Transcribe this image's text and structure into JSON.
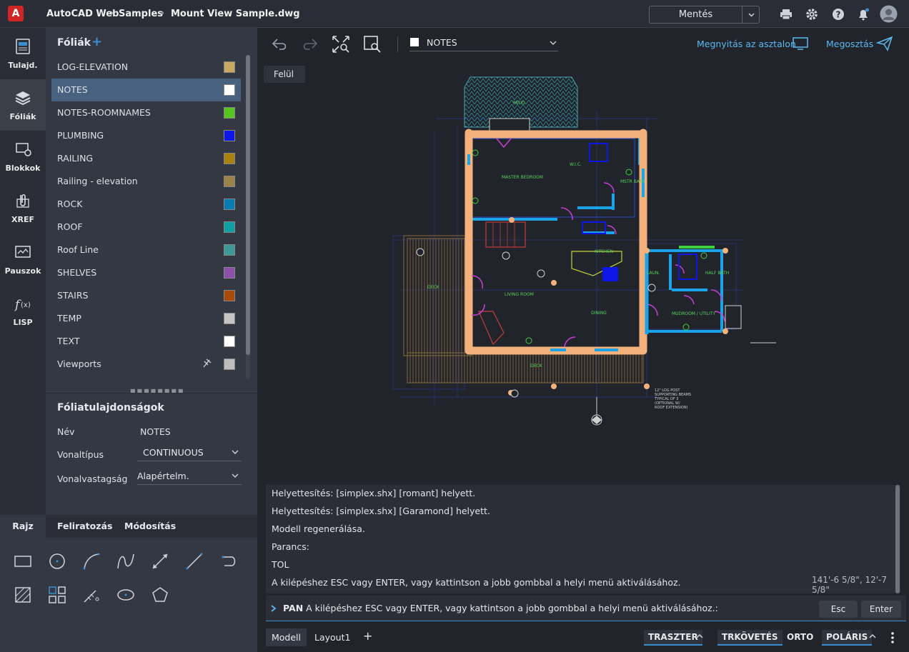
{
  "app": {
    "logo_letter": "A",
    "breadcrumb": [
      "AutoCAD Web",
      "Samples",
      "Mount View Sample.dwg"
    ],
    "save_label": "Mentés",
    "icons": [
      "printer-icon",
      "gear-icon",
      "help-icon",
      "bell-icon",
      "avatar"
    ]
  },
  "leftstrip": {
    "items": [
      {
        "label": "Tulajd.",
        "icon": "properties-icon"
      },
      {
        "label": "Fóliák",
        "icon": "layers-icon",
        "active": true
      },
      {
        "label": "Blokkok",
        "icon": "blocks-icon"
      },
      {
        "label": "XREF",
        "icon": "xref-icon"
      },
      {
        "label": "Pauszok",
        "icon": "trace-icon"
      },
      {
        "label": "LISP",
        "icon": "lisp-icon"
      }
    ]
  },
  "layers_panel": {
    "title": "Fóliák",
    "add_symbol": "+",
    "layers": [
      {
        "name": "LOG-ELEVATION",
        "color": "#c8a862"
      },
      {
        "name": "NOTES",
        "color": "#ffffff",
        "selected": true
      },
      {
        "name": "NOTES-ROOMNAMES",
        "color": "#56c51f"
      },
      {
        "name": "PLUMBING",
        "color": "#0f17e8"
      },
      {
        "name": "RAILING",
        "color": "#a98111"
      },
      {
        "name": "Railing - elevation",
        "color": "#9a8349"
      },
      {
        "name": "ROCK",
        "color": "#087bb0"
      },
      {
        "name": "ROOF",
        "color": "#0f9fa3"
      },
      {
        "name": "Roof Line",
        "color": "#3e9994"
      },
      {
        "name": "SHELVES",
        "color": "#8c50a8"
      },
      {
        "name": "STAIRS",
        "color": "#a54b0c"
      },
      {
        "name": "TEMP",
        "color": "#c5c5c5"
      },
      {
        "name": "TEXT",
        "color": "#ffffff"
      },
      {
        "name": "Viewports",
        "color": "#bdbdbd"
      }
    ]
  },
  "layer_props": {
    "title": "Fóliatulajdonságok",
    "name_label": "Név",
    "name_value": "NOTES",
    "linetype_label": "Vonaltípus",
    "linetype_value": "CONTINUOUS",
    "lineweight_label": "Vonalvastagság",
    "lineweight_value": "Alapértelm."
  },
  "tool_tabs": [
    "Rajz",
    "Feliratozás",
    "Módosítás"
  ],
  "tools": [
    "rectangle-icon",
    "circle-icon",
    "arc-icon",
    "spline-icon",
    "line-icon",
    "polyline-icon",
    "ray-icon",
    "hatch-icon",
    "array-icon",
    "dimension-icon",
    "ellipse-icon",
    "polygon-icon"
  ],
  "toolbar": {
    "layer_name": "NOTES",
    "open_desktop": "Megnyitás az asztalon",
    "share": "Megosztás"
  },
  "view_tag": "Felül",
  "drawing_labels": [
    "PATIO",
    "MASTER BEDROOM",
    "W.I.C.",
    "MSTR BATH",
    "KITCHEN",
    "LIVING ROOM",
    "DINING",
    "DECK",
    "LAUN.",
    "HALF BATH",
    "MUDROOM / UTILITY",
    "DECK"
  ],
  "command_history": [
    "Helyettesítés: [simplex.shx] [romant] helyett.",
    "Helyettesítés: [simplex.shx] [Garamond] helyett.",
    "Modell regenerálása.",
    "Parancs:",
    "TOL",
    "A kilépéshez ESC vagy ENTER, vagy kattintson a jobb gombbal a helyi menü aktiválásához."
  ],
  "coordinates": "141'-6 5/8\", 12'-7 5/8\"",
  "command_line": {
    "prompt_cmd": "PAN",
    "prompt_text": "A kilépéshez ESC vagy ENTER, vagy kattintson a jobb gombbal a helyi menü aktiválásához.:",
    "esc": "Esc",
    "enter": "Enter"
  },
  "status": {
    "tabs": [
      "Modell",
      "Layout1"
    ],
    "add": "+",
    "buttons": [
      "TRASZTER",
      "TRKÖVETÉS",
      "ORTO",
      "POLÁRIS"
    ]
  },
  "colors": {
    "accent": "#3b8fd0",
    "wall": "#f3b27b",
    "wall_blue": "#1aa3e6",
    "door": "#c83fd3"
  }
}
